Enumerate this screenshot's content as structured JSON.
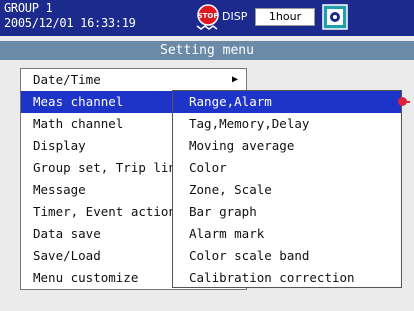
{
  "header": {
    "group": "GROUP 1",
    "datetime": "2005/12/01 16:33:19",
    "disp_label": "DISP",
    "time_button": "1hour",
    "stop_icon": "stop-icon",
    "disk_icon": "disk-icon",
    "stop_icon_text": "STOP"
  },
  "title": "Setting menu",
  "main_menu": {
    "items": [
      {
        "label": "Date/Time"
      },
      {
        "label": "Meas channel"
      },
      {
        "label": "Math channel"
      },
      {
        "label": "Display"
      },
      {
        "label": "Group set, Trip line"
      },
      {
        "label": "Message"
      },
      {
        "label": "Timer, Event action"
      },
      {
        "label": "Data save"
      },
      {
        "label": "Save/Load"
      },
      {
        "label": "Menu customize"
      }
    ],
    "selected": "Meas channel"
  },
  "sub_menu": {
    "items": [
      {
        "label": "Range,Alarm"
      },
      {
        "label": "Tag,Memory,Delay"
      },
      {
        "label": "Moving average"
      },
      {
        "label": "Color"
      },
      {
        "label": "Zone, Scale"
      },
      {
        "label": "Bar graph"
      },
      {
        "label": "Alarm mark"
      },
      {
        "label": "Color scale band"
      },
      {
        "label": "Calibration correction"
      }
    ],
    "selected": "Range,Alarm"
  },
  "colors": {
    "header_bg": "#1b2a8c",
    "title_bg": "#6b8aa8",
    "selection": "#1e34c8",
    "pointer": "#e0203a"
  }
}
